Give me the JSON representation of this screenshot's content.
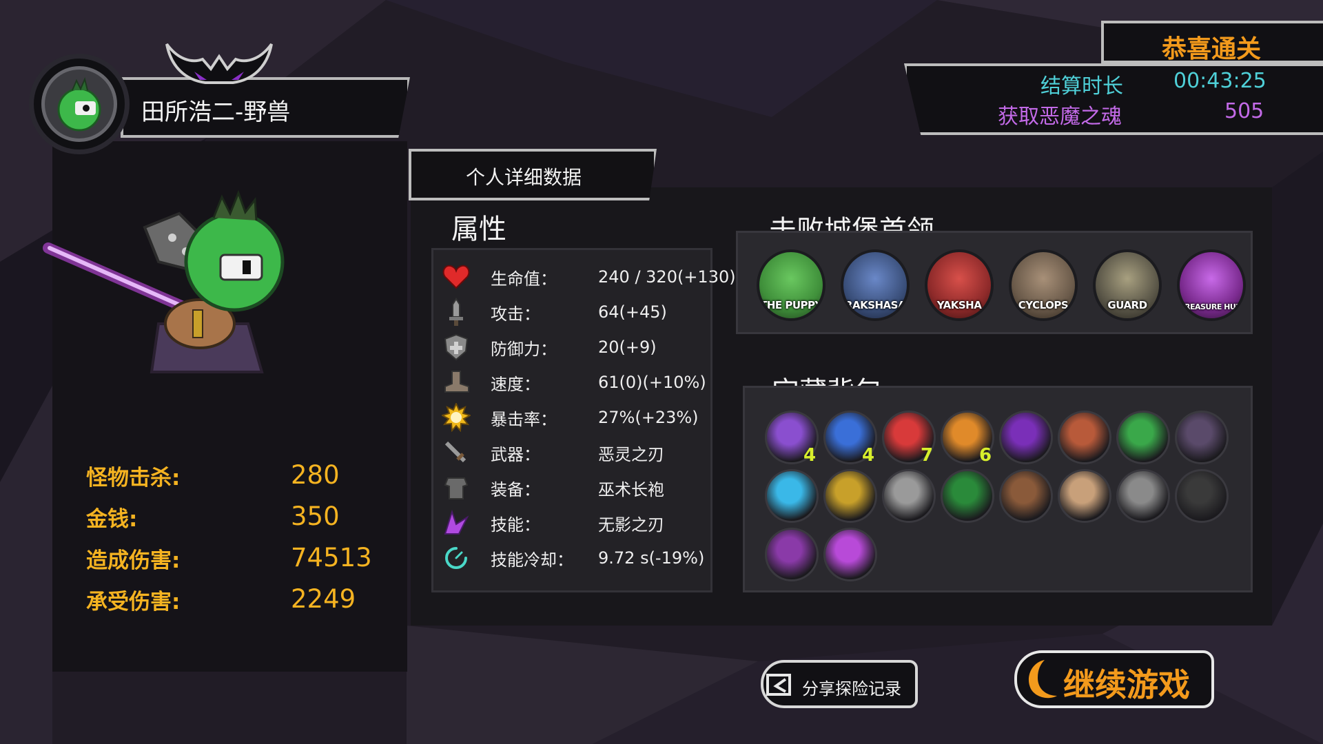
{
  "player": {
    "name": "田所浩二-野兽"
  },
  "stats": {
    "kills_label": "怪物击杀:",
    "kills": "280",
    "gold_label": "金钱:",
    "gold": "350",
    "damage_dealt_label": "造成伤害:",
    "damage_dealt": "74513",
    "damage_taken_label": "承受伤害:",
    "damage_taken": "2249"
  },
  "tab": {
    "label": "个人详细数据"
  },
  "attributes": {
    "title": "属性",
    "rows": [
      {
        "icon": "heart-icon",
        "label": "生命值：",
        "value": "240 / 320(+130)"
      },
      {
        "icon": "sword-icon",
        "label": "攻击：",
        "value": "64(+45)"
      },
      {
        "icon": "shield-icon",
        "label": "防御力：",
        "value": "20(+9)"
      },
      {
        "icon": "boot-icon",
        "label": "速度：",
        "value": "61(0)(+10%)"
      },
      {
        "icon": "sun-icon",
        "label": "暴击率：",
        "value": "27%(+23%)"
      },
      {
        "icon": "weapon-icon",
        "label": "武器：",
        "value": "恶灵之刃"
      },
      {
        "icon": "armor-icon",
        "label": "装备：",
        "value": "巫术长袍"
      },
      {
        "icon": "skill-icon",
        "label": "技能：",
        "value": "无影之刃"
      },
      {
        "icon": "cooldown-icon",
        "label": "技能冷却：",
        "value": "9.72 s(-19%)"
      }
    ]
  },
  "bosses": {
    "title": "击败城堡首领",
    "list": [
      {
        "name": "THE PUPPY",
        "color": "#3f8f3a"
      },
      {
        "name": "RAKSHASA",
        "color": "#3a4f7a"
      },
      {
        "name": "YAKSHA",
        "color": "#8e2a2a"
      },
      {
        "name": "CYCLOPS",
        "color": "#6a5a4a"
      },
      {
        "name": "GUARD",
        "color": "#5a5648"
      },
      {
        "name": "TREASURE HUNTER",
        "color": "#7a2a8e"
      }
    ]
  },
  "treasure": {
    "title": "宝藏背包",
    "items": [
      {
        "icon": "purple-crystal-icon",
        "color": "#8a4fcf",
        "count": "4"
      },
      {
        "icon": "blue-crystal-icon",
        "color": "#3a6fd8",
        "count": "4"
      },
      {
        "icon": "red-crystal-icon",
        "color": "#d83a3a",
        "count": "7"
      },
      {
        "icon": "amber-crystal-icon",
        "color": "#e08a2a",
        "count": "6"
      },
      {
        "icon": "purple-dragon-icon",
        "color": "#7a2fb8",
        "count": ""
      },
      {
        "icon": "demon-mask-icon",
        "color": "#b85a3a",
        "count": ""
      },
      {
        "icon": "green-potion-icon",
        "color": "#3aa84a",
        "count": ""
      },
      {
        "icon": "dark-claw-icon",
        "color": "#5a4a6a",
        "count": ""
      },
      {
        "icon": "snowflake-icon",
        "color": "#3ab8e8",
        "count": ""
      },
      {
        "icon": "gold-ring-icon",
        "color": "#c8a02a",
        "count": ""
      },
      {
        "icon": "helmet-icon",
        "color": "#9a9a9a",
        "count": ""
      },
      {
        "icon": "clover-icon",
        "color": "#2a8a3a",
        "count": ""
      },
      {
        "icon": "horned-helm-icon",
        "color": "#8a5a3a",
        "count": ""
      },
      {
        "icon": "scroll-icon",
        "color": "#c8a07a",
        "count": ""
      },
      {
        "icon": "gauntlet-icon",
        "color": "#8a8a8a",
        "count": ""
      },
      {
        "icon": "dark-ring-icon",
        "color": "#3a3a3a",
        "count": ""
      },
      {
        "icon": "purple-ring-icon",
        "color": "#8a3aa8",
        "count": ""
      },
      {
        "icon": "purple-blade-icon",
        "color": "#b84ad8",
        "count": ""
      }
    ]
  },
  "result": {
    "title": "恭喜通关",
    "time_label": "结算时长",
    "time_value": "00:43:25",
    "souls_label": "获取恶魔之魂",
    "souls_value": "505"
  },
  "buttons": {
    "share": "分享探险记录",
    "continue": "继续游戏"
  },
  "colors": {
    "accent_orange": "#f39a1c",
    "stat_gold": "#f5b321",
    "time_cyan": "#4fd0d8",
    "soul_purple": "#c36ae8",
    "count_yellow": "#d8ef2c"
  }
}
